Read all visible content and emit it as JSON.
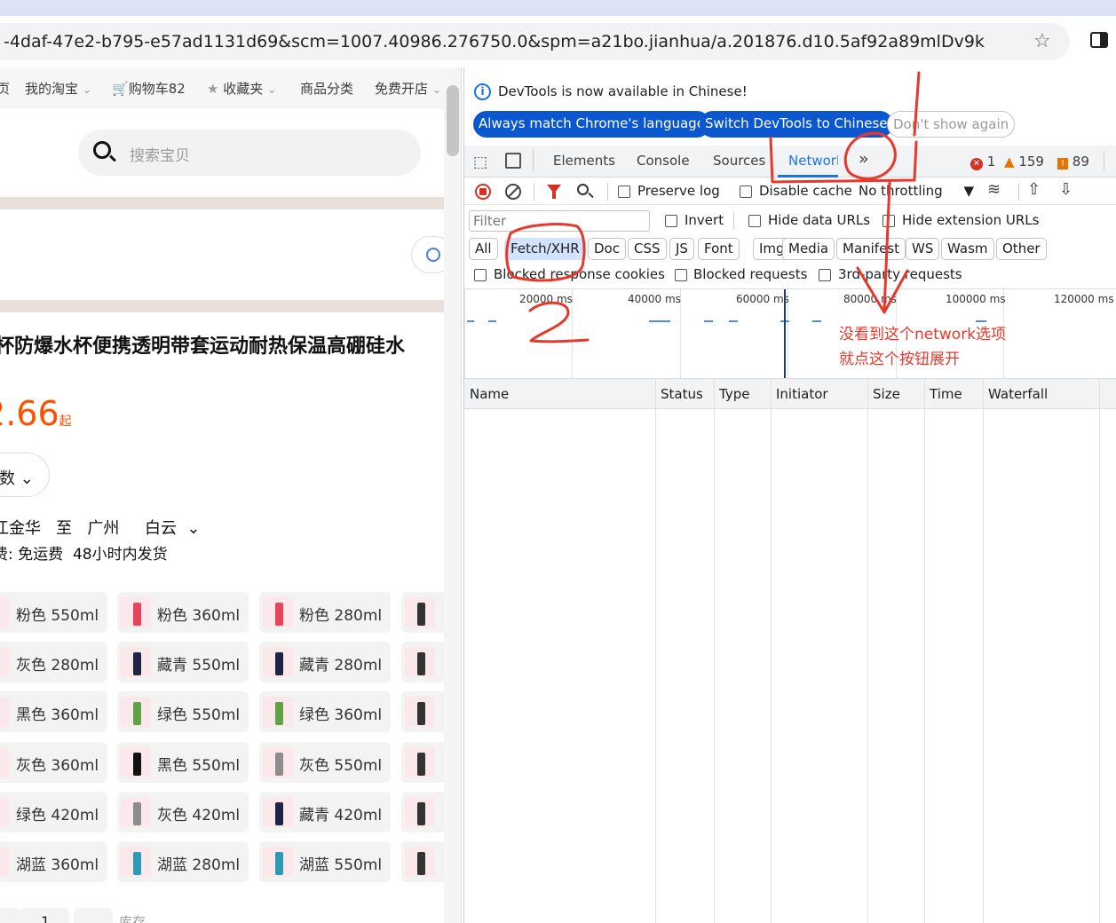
{
  "browser": {
    "url": "-4daf-47e2-b795-e57ad1131d69&scm=1007.40986.276750.0&spm=a21bo.jianhua/a.201876.d10.5af92a89mlDv9k",
    "bookmark_icon": "star-icon",
    "sidepanel_icon": "side-panel-icon"
  },
  "shop": {
    "nav": {
      "item0": "页",
      "my_taobao": "我的淘宝",
      "cart": "购物车82",
      "favorites": "收藏夹",
      "categories": "商品分类",
      "open_shop": "免费开店"
    },
    "search_placeholder": "搜索宝贝",
    "product_title": "防爆水杯便携透明带套运动耐热保温高硼硅水",
    "price": ".66",
    "price_suffix": "起",
    "quantity_label": "数",
    "shipping_from": "金华",
    "shipping_to_word": "至",
    "shipping_city": "广州",
    "shipping_district": "白云",
    "shipping_prefix": "江",
    "shipping_fee": "费: 免运费",
    "delivery": "48小时内发货",
    "skus": [
      [
        "粉色 550ml",
        "粉色 360ml",
        "粉色 280ml"
      ],
      [
        "灰色 280ml",
        "藏青 550ml",
        "藏青 280ml"
      ],
      [
        "黑色 360ml",
        "绿色 550ml",
        "绿色 360ml"
      ],
      [
        "灰色 360ml",
        "黑色 550ml",
        "灰色 550ml"
      ],
      [
        "绿色 420ml",
        "灰色 420ml",
        "藏青 420ml"
      ],
      [
        "湖蓝 360ml",
        "湖蓝 280ml",
        "湖蓝 550ml"
      ]
    ],
    "pager_label": "1",
    "stock_label": "库存"
  },
  "devtools": {
    "info": "DevTools is now available in Chinese!",
    "btn_match": "Always match Chrome's language",
    "btn_switch": "Switch DevTools to Chinese",
    "btn_dont": "Don't show again",
    "tabs": {
      "elements": "Elements",
      "console": "Console",
      "sources": "Sources",
      "network": "Network",
      "more": "»"
    },
    "counts": {
      "errors": "1",
      "warnings": "159",
      "issues": "89"
    },
    "toolbar": {
      "preserve_log": "Preserve log",
      "disable_cache": "Disable cache",
      "throttling": "No throttling"
    },
    "filter": {
      "placeholder": "Filter",
      "invert": "Invert",
      "hide_data": "Hide data URLs",
      "hide_ext": "Hide extension URLs"
    },
    "types": [
      "All",
      "Fetch/XHR",
      "Doc",
      "CSS",
      "JS",
      "Font",
      "Img",
      "Media",
      "Manifest",
      "WS",
      "Wasm",
      "Other"
    ],
    "blocked_cookies": "Blocked response cookies",
    "blocked_requests": "Blocked requests",
    "third_party": "3rd-party requests",
    "timeline_ticks": [
      "20000 ms",
      "40000 ms",
      "60000 ms",
      "80000 ms",
      "100000 ms",
      "120000 ms"
    ],
    "columns": [
      "Name",
      "Status",
      "Type",
      "Initiator",
      "Size",
      "Time",
      "Waterfall"
    ]
  },
  "annotations": {
    "note_line1": "没看到这个network选项",
    "note_line2": "就点这个按钮展开",
    "mark_1": "1",
    "mark_2": "2",
    "color": "#e8372b"
  }
}
